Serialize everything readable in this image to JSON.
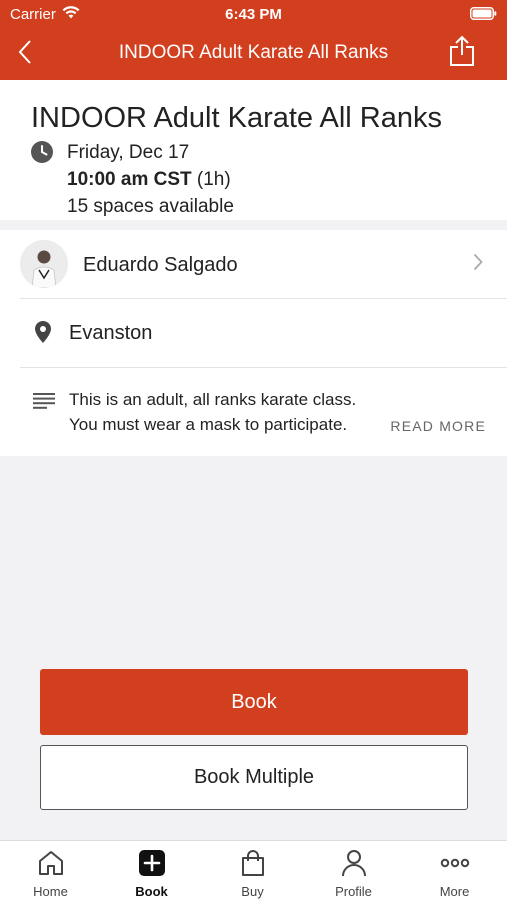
{
  "status_bar": {
    "carrier": "Carrier",
    "time": "6:43 PM"
  },
  "navbar": {
    "title": "INDOOR Adult Karate All Ranks"
  },
  "summary": {
    "title": "INDOOR Adult Karate All Ranks",
    "date": "Friday, Dec 17",
    "time": "10:00 am CST",
    "duration": "(1h)",
    "spaces": "15 spaces available"
  },
  "instructor": {
    "name": "Eduardo Salgado"
  },
  "location": {
    "name": "Evanston"
  },
  "description": {
    "line1": "This is an adult, all ranks karate class.",
    "line2": "You must wear a mask to participate.",
    "read_more": "READ MORE"
  },
  "actions": {
    "book": "Book",
    "book_multiple": "Book Multiple"
  },
  "tabbar": {
    "items": [
      {
        "label": "Home",
        "icon": "home-icon"
      },
      {
        "label": "Book",
        "icon": "book-plus-icon"
      },
      {
        "label": "Buy",
        "icon": "shopping-bag-icon"
      },
      {
        "label": "Profile",
        "icon": "person-icon"
      },
      {
        "label": "More",
        "icon": "more-dots-icon"
      }
    ],
    "active": "Book"
  },
  "colors": {
    "brand": "#d23f1f",
    "background": "#f2f2f4"
  }
}
